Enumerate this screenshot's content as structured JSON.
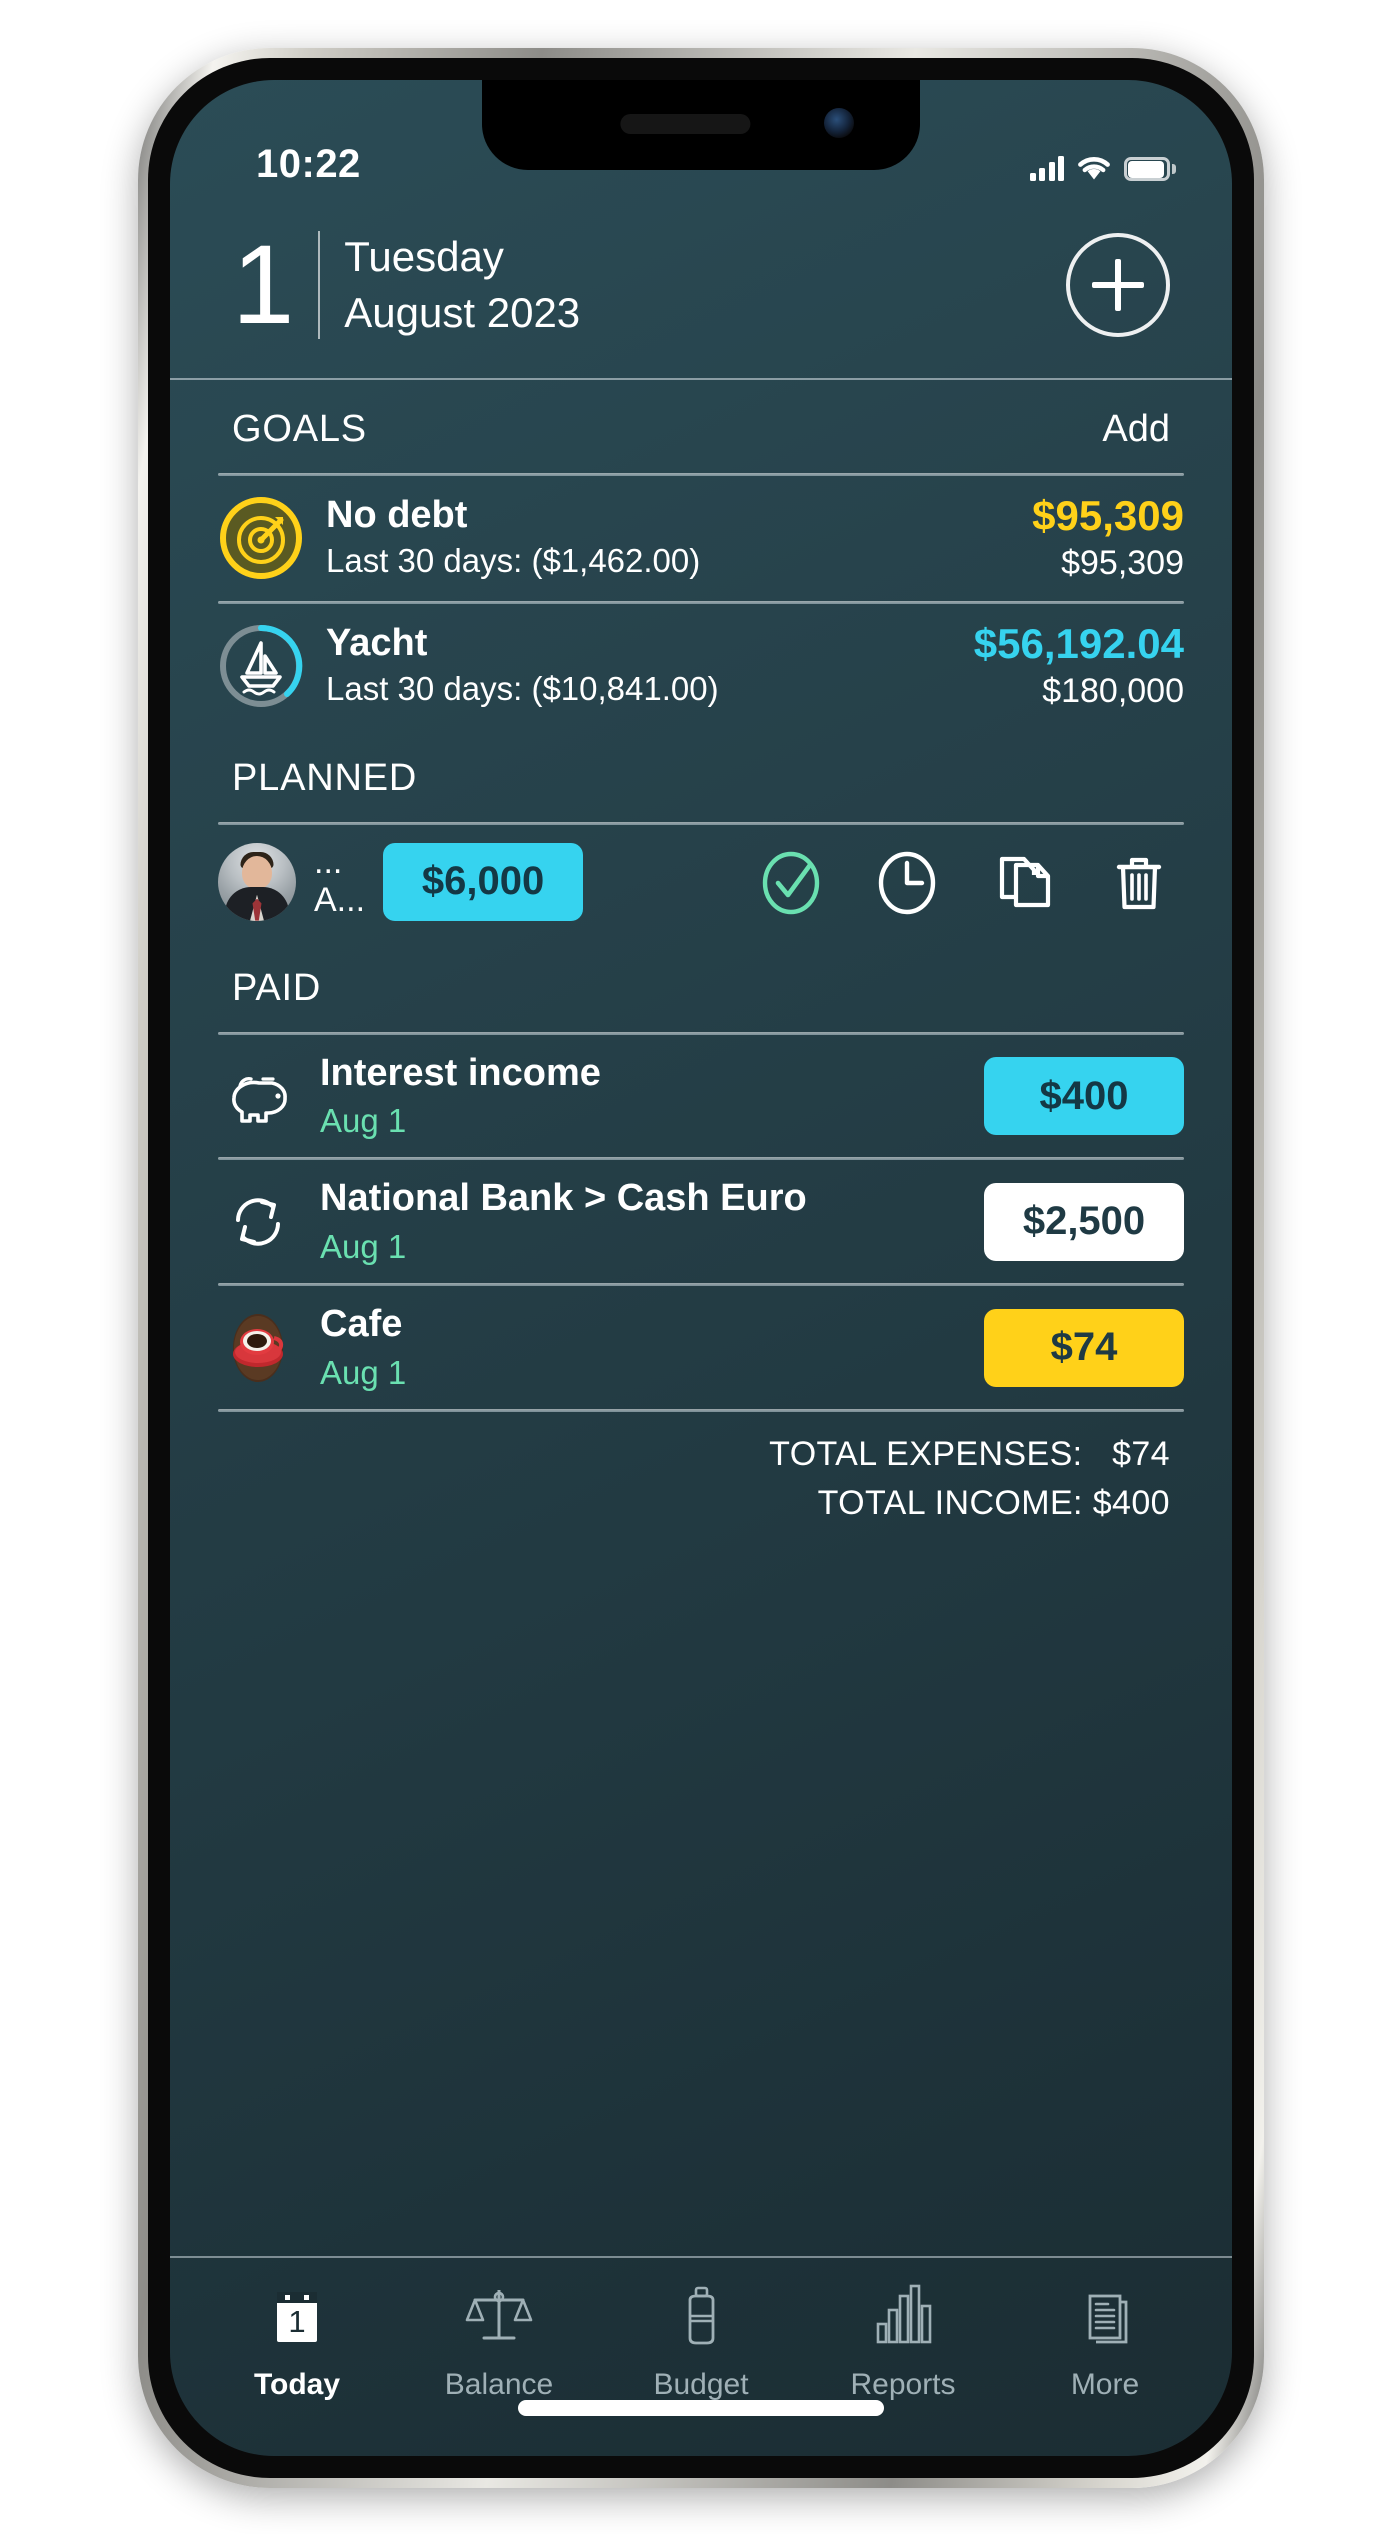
{
  "status_bar": {
    "time": "10:22",
    "cellular_icon": "cellular-bars-icon",
    "wifi_icon": "wifi-icon",
    "battery_icon": "battery-icon"
  },
  "header": {
    "day": "1",
    "weekday": "Tuesday",
    "month_year": "August 2023",
    "add_button_icon": "plus-icon"
  },
  "goals": {
    "title": "GOALS",
    "add_label": "Add",
    "items": [
      {
        "icon": "target-goal-icon",
        "name": "No debt",
        "subtitle": "Last 30 days: ($1,462.00)",
        "amount": "$95,309",
        "amount_color": "#ffd119",
        "target": "$95,309",
        "progress": 1.0,
        "ring_color": "#ffd119"
      },
      {
        "icon": "sailboat-goal-icon",
        "name": "Yacht",
        "subtitle": "Last 30 days: ($10,841.00)",
        "amount": "$56,192.04",
        "amount_color": "#36d3ef",
        "target": "$180,000",
        "progress": 0.31,
        "ring_color": "#36d3ef"
      }
    ]
  },
  "planned": {
    "title": "PLANNED",
    "row": {
      "avatar": "person-avatar",
      "line1": "...",
      "line2": "A...",
      "amount": "$6,000",
      "amount_style": "cyan",
      "actions": [
        {
          "icon": "check-circle-icon",
          "label": "mark-paid"
        },
        {
          "icon": "clock-icon",
          "label": "postpone"
        },
        {
          "icon": "copy-documents-icon",
          "label": "duplicate"
        },
        {
          "icon": "trash-icon",
          "label": "delete"
        }
      ]
    }
  },
  "paid": {
    "title": "PAID",
    "items": [
      {
        "icon": "piggy-bank-icon",
        "name": "Interest income",
        "date": "Aug 1",
        "amount": "$400",
        "amount_style": "cyan"
      },
      {
        "icon": "transfer-arrows-icon",
        "name": "National Bank > Cash Euro",
        "date": "Aug 1",
        "amount": "$2,500",
        "amount_style": "white"
      },
      {
        "icon": "coffee-cup-icon",
        "name": "Cafe",
        "date": "Aug 1",
        "amount": "$74",
        "amount_style": "yellow"
      }
    ]
  },
  "totals": {
    "expenses_label": "TOTAL EXPENSES:",
    "expenses_value": "$74",
    "income_label": "TOTAL INCOME:",
    "income_value": "$400"
  },
  "tab_bar": {
    "items": [
      {
        "icon": "calendar-today-icon",
        "label": "Today",
        "active": true
      },
      {
        "icon": "scales-balance-icon",
        "label": "Balance",
        "active": false
      },
      {
        "icon": "budget-jar-icon",
        "label": "Budget",
        "active": false
      },
      {
        "icon": "bar-chart-reports-icon",
        "label": "Reports",
        "active": false
      },
      {
        "icon": "documents-more-icon",
        "label": "More",
        "active": false
      }
    ]
  },
  "theme": {
    "bg_top": "#2b4c56",
    "bg_bottom": "#1b2d33",
    "accent_cyan": "#36d3ef",
    "accent_yellow": "#ffd119",
    "accent_green": "#6ae0b0",
    "text_white": "#ffffff",
    "tab_inactive": "#9fb0b6"
  }
}
